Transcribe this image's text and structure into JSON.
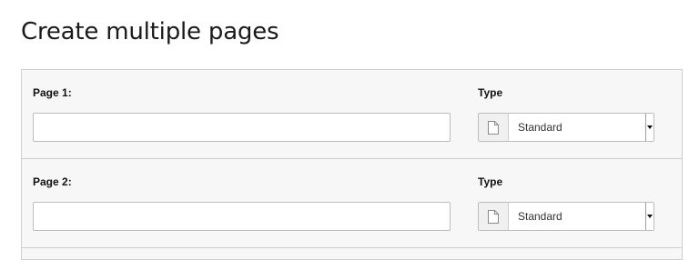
{
  "page_title": "Create multiple pages",
  "rows": [
    {
      "title_label": "Page 1:",
      "title_value": "",
      "type_label": "Type",
      "type_value": "Standard",
      "type_icon": "page-doc-icon"
    },
    {
      "title_label": "Page 2:",
      "title_value": "",
      "type_label": "Type",
      "type_value": "Standard",
      "type_icon": "page-doc-icon"
    }
  ],
  "colors": {
    "panel_bg": "#f7f7f7",
    "border": "#cfcfcf",
    "input_border": "#bdbdbd"
  }
}
